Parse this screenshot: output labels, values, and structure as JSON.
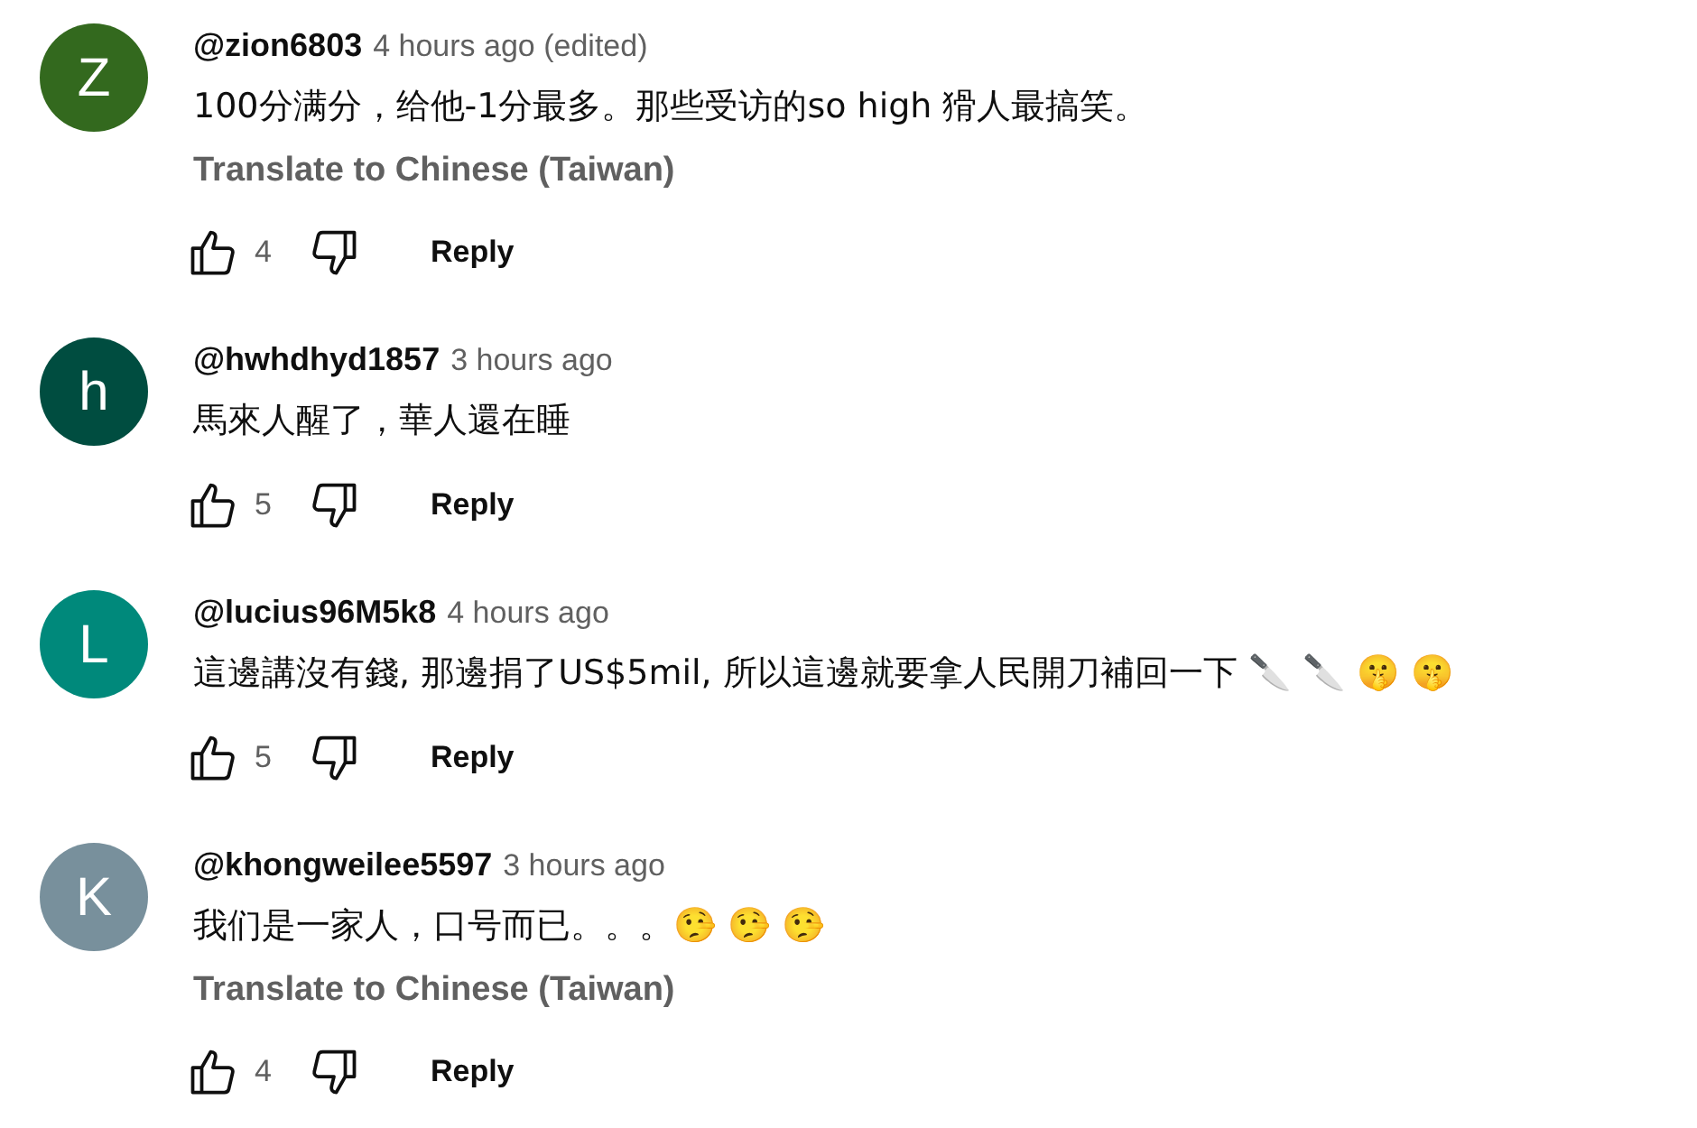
{
  "comments": [
    {
      "avatar_letter": "Z",
      "color": "#33691e",
      "author": "@zion6803",
      "time": "4 hours ago (edited)",
      "text": "100分满分，给他-1分最多。那些受访的so high 猾人最搞笑。",
      "translate": "Translate to Chinese (Taiwan)",
      "likes": "4",
      "reply": "Reply"
    },
    {
      "avatar_letter": "h",
      "color": "#004d40",
      "author": "@hwhdhyd1857",
      "time": "3 hours ago",
      "text": "馬來人醒了，華人還在睡",
      "likes": "5",
      "reply": "Reply"
    },
    {
      "avatar_letter": "L",
      "color": "#00897b",
      "author": "@lucius96M5k8",
      "time": "4 hours ago",
      "text": "這邊講沒有錢, 那邊捐了US$5mil, 所以這邊就要拿人民開刀補回一下 🔪 🔪 🤫 🤫",
      "likes": "5",
      "reply": "Reply"
    },
    {
      "avatar_letter": "K",
      "color": "#78909c",
      "author": "@khongweilee5597",
      "time": "3 hours ago",
      "text": "我们是一家人，口号而已。。。🤥 🤥 🤥",
      "translate": "Translate to Chinese (Taiwan)",
      "likes": "4",
      "reply": "Reply"
    }
  ]
}
